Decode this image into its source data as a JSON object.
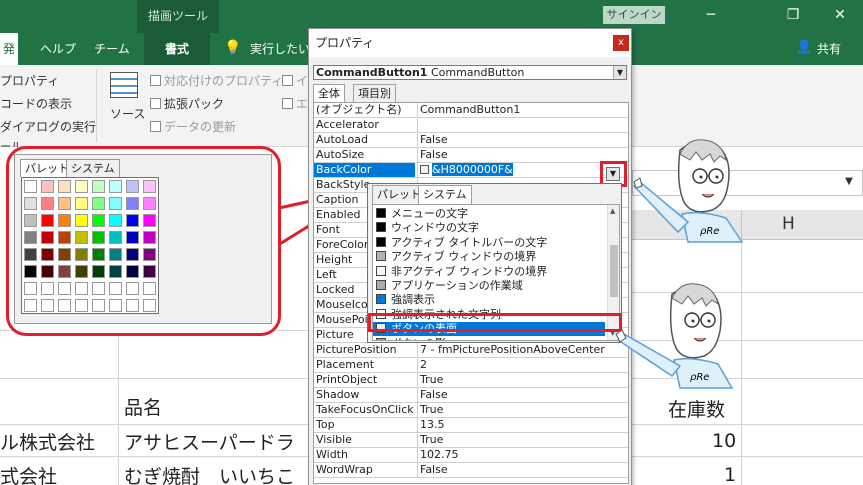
{
  "titlebar": {
    "context_tab": "描画ツール",
    "signin": "サインイン",
    "minimize": "─",
    "restore": "❐",
    "close": "✕"
  },
  "ribbon_tabs": {
    "developer_partial": "発",
    "help": "ヘルプ",
    "team": "チーム",
    "format": "書式",
    "tellme": "実行したい",
    "share": "共有"
  },
  "ribbon": {
    "properties": "プロパティ",
    "view_code": "コードの表示",
    "dialog_run": "ダイアログの実行",
    "control_partial": "ール",
    "source": "ソース",
    "map_props": "対応付けのプロパティ",
    "expansion_pack": "拡張パック",
    "refresh_data": "データの更新",
    "import_partial": "イ",
    "export_partial": "エ"
  },
  "sheet": {
    "col_h": "H",
    "hdr_product": "品名",
    "hdr_stock": "在庫数",
    "row1_company": "ル株式会社",
    "row1_product": "アサヒスーパードラ",
    "row1_stock": "10",
    "row2_company": "式会社",
    "row2_product": "むぎ焼酎　いいちこ",
    "row2_stock": "1"
  },
  "properties_window": {
    "title": "プロパティ",
    "close": "x",
    "object_name": "CommandButton1",
    "object_type": "CommandButton",
    "tab_all": "全体",
    "tab_category": "項目別",
    "rows": [
      {
        "name": "(オブジェクト名)",
        "value": "CommandButton1"
      },
      {
        "name": "Accelerator",
        "value": ""
      },
      {
        "name": "AutoLoad",
        "value": "False"
      },
      {
        "name": "AutoSize",
        "value": "False"
      },
      {
        "name": "BackColor",
        "value": "&H8000000F&"
      },
      {
        "name": "BackStyle",
        "value": ""
      },
      {
        "name": "Caption",
        "value": ""
      },
      {
        "name": "Enabled",
        "value": ""
      },
      {
        "name": "Font",
        "value": ""
      },
      {
        "name": "ForeColor",
        "value": ""
      },
      {
        "name": "Height",
        "value": ""
      },
      {
        "name": "Left",
        "value": ""
      },
      {
        "name": "Locked",
        "value": ""
      },
      {
        "name": "MouseIcon",
        "value": ""
      },
      {
        "name": "MousePointer",
        "value": ""
      },
      {
        "name": "Picture",
        "value": ""
      },
      {
        "name": "PicturePosition",
        "value": "7 - fmPicturePositionAboveCenter"
      },
      {
        "name": "Placement",
        "value": "2"
      },
      {
        "name": "PrintObject",
        "value": "True"
      },
      {
        "name": "Shadow",
        "value": "False"
      },
      {
        "name": "TakeFocusOnClick",
        "value": "True"
      },
      {
        "name": "Top",
        "value": "13.5"
      },
      {
        "name": "Visible",
        "value": "True"
      },
      {
        "name": "Width",
        "value": "102.75"
      },
      {
        "name": "WordWrap",
        "value": "False"
      }
    ]
  },
  "dropdown": {
    "tab_palette": "パレット",
    "tab_system": "システム",
    "items": [
      {
        "label": "メニューの文字",
        "color": "#000000"
      },
      {
        "label": "ウィンドウの文字",
        "color": "#000000"
      },
      {
        "label": "アクティブ タイトルバーの文字",
        "color": "#000000"
      },
      {
        "label": "アクティブ ウィンドウの境界",
        "color": "#b4b4b4"
      },
      {
        "label": "非アクティブ ウィンドウの境界",
        "color": "#f4f7fc"
      },
      {
        "label": "アプリケーションの作業域",
        "color": "#ababab"
      },
      {
        "label": "強調表示",
        "color": "#0078d7"
      },
      {
        "label": "強調表示された文字列",
        "color": "#ffffff"
      },
      {
        "label": "ボタンの表面",
        "color": "#f0f0f0"
      },
      {
        "label": "ボタンの影",
        "color": "#a0a0a0"
      }
    ],
    "selected_index": 8
  },
  "callout": {
    "tab_palette": "パレット",
    "tab_system": "システム",
    "palette_rows": [
      [
        "#ffffff",
        "#ffc0c0",
        "#ffe0c0",
        "#ffffc0",
        "#c0ffc0",
        "#c0ffff",
        "#c0c0ff",
        "#ffc0ff"
      ],
      [
        "#e0e0e0",
        "#ff8080",
        "#ffc080",
        "#ffff80",
        "#80ff80",
        "#80ffff",
        "#8080ff",
        "#ff80ff"
      ],
      [
        "#c0c0c0",
        "#ff0000",
        "#ff8000",
        "#ffff00",
        "#00ff00",
        "#00ffff",
        "#0000ff",
        "#ff00ff"
      ],
      [
        "#808080",
        "#c00000",
        "#c04000",
        "#c0c000",
        "#00c000",
        "#00c0c0",
        "#0000c0",
        "#c000c0"
      ],
      [
        "#404040",
        "#800000",
        "#804000",
        "#808000",
        "#008000",
        "#008080",
        "#000080",
        "#800080"
      ],
      [
        "#000000",
        "#400000",
        "#804040",
        "#404000",
        "#004000",
        "#004040",
        "#000040",
        "#400040"
      ],
      [
        "#ffffff",
        "#ffffff",
        "#ffffff",
        "#ffffff",
        "#ffffff",
        "#ffffff",
        "#ffffff",
        "#ffffff"
      ],
      [
        "#ffffff",
        "#ffffff",
        "#ffffff",
        "#ffffff",
        "#ffffff",
        "#ffffff",
        "#ffffff",
        "#ffffff"
      ]
    ]
  },
  "characters": {
    "label": "ρRе"
  },
  "colors": {
    "excel_green": "#217346",
    "highlight_red": "#e31e2c",
    "selection_blue": "#0078d7"
  }
}
